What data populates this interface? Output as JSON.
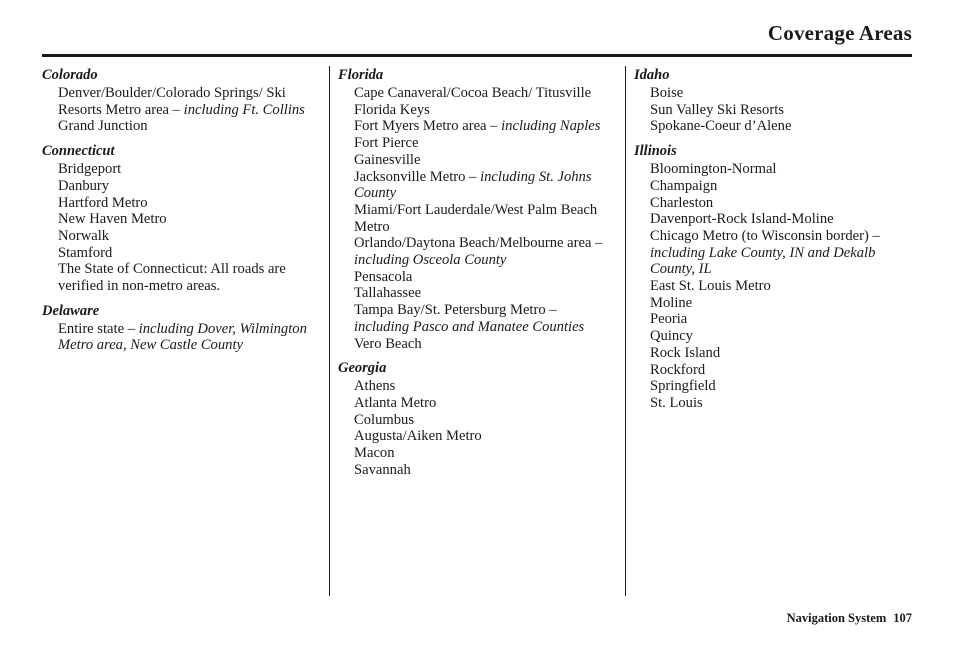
{
  "header": {
    "title": "Coverage Areas"
  },
  "footer": {
    "label": "Navigation System",
    "page_number": "107"
  },
  "columns": [
    {
      "states": [
        {
          "name": "Colorado",
          "cities": [
            "Denver/Boulder/Colorado Springs/ Ski Resorts Metro area – <em>including Ft. Collins</em>",
            "Grand Junction"
          ]
        },
        {
          "name": "Connecticut",
          "cities": [
            "Bridgeport",
            "Danbury",
            "Hartford Metro",
            "New Haven Metro",
            "Norwalk",
            "Stamford",
            "The State of Connecticut: All roads are verified in non-metro areas."
          ]
        },
        {
          "name": "Delaware",
          "cities": [
            "Entire state – <em>including Dover, Wilmington Metro area, New Castle County</em>"
          ]
        }
      ]
    },
    {
      "states": [
        {
          "name": "Florida",
          "cities": [
            "Cape Canaveral/Cocoa Beach/ Titusville",
            "Florida Keys",
            "Fort Myers Metro area – <em>including Naples</em>",
            "Fort Pierce",
            "Gainesville",
            "Jacksonville Metro – <em>including St. Johns County</em>",
            "Miami/Fort Lauderdale/West Palm Beach Metro",
            "Orlando/Daytona Beach/Melbourne area – <em>including Osceola County</em>",
            "Pensacola",
            "Tallahassee",
            "Tampa Bay/St. Petersburg Metro – <em>including Pasco and Manatee Counties</em>",
            "Vero Beach"
          ]
        },
        {
          "name": "Georgia",
          "cities": [
            "Athens",
            "Atlanta Metro",
            "Columbus",
            "Augusta/Aiken Metro",
            "Macon",
            "Savannah"
          ]
        }
      ]
    },
    {
      "states": [
        {
          "name": "Idaho",
          "cities": [
            "Boise",
            "Sun Valley Ski Resorts",
            "Spokane-Coeur d’Alene"
          ]
        },
        {
          "name": "Illinois",
          "cities": [
            "Bloomington-Normal",
            "Champaign",
            "Charleston",
            "Davenport-Rock Island-Moline",
            "Chicago Metro (to Wisconsin border) <em>– including Lake County, IN and Dekalb County, IL</em>",
            "East St. Louis Metro",
            "Moline",
            "Peoria",
            "Quincy",
            "Rock Island",
            "Rockford",
            "Springfield",
            "St. Louis"
          ]
        }
      ]
    }
  ]
}
